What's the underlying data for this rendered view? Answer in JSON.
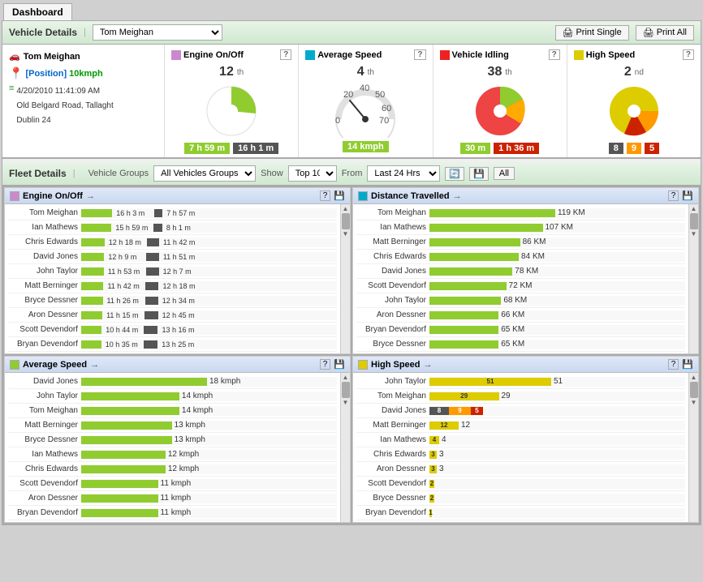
{
  "tabs": [
    {
      "label": "Dashboard"
    }
  ],
  "vehicleDetails": {
    "title": "Vehicle Details",
    "selectedVehicle": "Tom Meighan",
    "printSingle": "Print Single",
    "printAll": "Print All",
    "vehicle": {
      "name": "Tom Meighan",
      "position": "[Position]",
      "speed": "10kmph",
      "datetime": "4/20/2010 11:41:09 AM",
      "address": "Old Belgard Road, Tallaght",
      "city": "Dublin 24"
    },
    "metrics": [
      {
        "id": "engine",
        "label": "Engine On/Off",
        "color": "#cc88cc",
        "rank": "12",
        "rankSuffix": "th",
        "helpIcon": "?",
        "footer": [
          "7 h 59 m",
          "16 h 1 m"
        ],
        "footerColors": [
          "green",
          "dark"
        ]
      },
      {
        "id": "avgspeed",
        "label": "Average Speed",
        "color": "#00aacc",
        "rank": "4",
        "rankSuffix": "th",
        "helpIcon": "?",
        "footer": [
          "14 kmph"
        ],
        "footerColors": [
          "green"
        ]
      },
      {
        "id": "idling",
        "label": "Vehicle Idling",
        "color": "#ee2222",
        "rank": "38",
        "rankSuffix": "th",
        "helpIcon": "?",
        "footer": [
          "30 m",
          "1 h 36 m"
        ],
        "footerColors": [
          "green",
          "red"
        ]
      },
      {
        "id": "highspeed",
        "label": "High Speed",
        "color": "#ddcc00",
        "rank": "2",
        "rankSuffix": "nd",
        "helpIcon": "?",
        "footer": [
          "8",
          "9",
          "5"
        ],
        "footerColors": [
          "dark",
          "orange",
          "red"
        ]
      }
    ]
  },
  "fleetDetails": {
    "title": "Fleet Details",
    "vehicleGroupsLabel": "Vehicle Groups",
    "vehicleGroupsValue": "All Vehicles Groups",
    "showLabel": "Show",
    "showValue": "Top 10",
    "fromLabel": "From",
    "fromValue": "Last 24 Hrs",
    "allLabel": "All"
  },
  "engineChart": {
    "title": "Engine On/Off",
    "color": "#cc88cc",
    "rows": [
      {
        "name": "Tom Meighan",
        "val1": "16 h 3 m",
        "pct1": 85,
        "val2": "7 h 57 m",
        "pct2": 40
      },
      {
        "name": "Ian Mathews",
        "val1": "15 h 59 m",
        "pct1": 83,
        "val2": "8 h 1 m",
        "pct2": 42
      },
      {
        "name": "Chris Edwards",
        "val1": "12 h 18 m",
        "pct1": 64,
        "val2": "11 h 42 m",
        "pct2": 61
      },
      {
        "name": "David Jones",
        "val1": "12 h 9 m",
        "pct1": 63,
        "val2": "11 h 51 m",
        "pct2": 62
      },
      {
        "name": "John Taylor",
        "val1": "11 h 53 m",
        "pct1": 62,
        "val2": "12 h 7 m",
        "pct2": 63
      },
      {
        "name": "Matt Berninger",
        "val1": "11 h 42 m",
        "pct1": 61,
        "val2": "12 h 18 m",
        "pct2": 64
      },
      {
        "name": "Bryce Dessner",
        "val1": "11 h 26 m",
        "pct1": 59,
        "val2": "12 h 34 m",
        "pct2": 65
      },
      {
        "name": "Aron Dessner",
        "val1": "11 h 15 m",
        "pct1": 58,
        "val2": "12 h 45 m",
        "pct2": 66
      },
      {
        "name": "Scott Devendorf",
        "val1": "10 h 44 m",
        "pct1": 56,
        "val2": "13 h 16 m",
        "pct2": 69
      },
      {
        "name": "Bryan Devendorf",
        "val1": "10 h 35 m",
        "pct1": 55,
        "val2": "13 h 25 m",
        "pct2": 70
      }
    ]
  },
  "distanceChart": {
    "title": "Distance Travelled",
    "color": "#00aacc",
    "rows": [
      {
        "name": "Tom Meighan",
        "val": "119 KM",
        "pct": 100
      },
      {
        "name": "Ian Mathews",
        "val": "107 KM",
        "pct": 90
      },
      {
        "name": "Matt Berninger",
        "val": "86 KM",
        "pct": 72
      },
      {
        "name": "Chris Edwards",
        "val": "84 KM",
        "pct": 71
      },
      {
        "name": "David Jones",
        "val": "78 KM",
        "pct": 66
      },
      {
        "name": "Scott Devendorf",
        "val": "72 KM",
        "pct": 61
      },
      {
        "name": "John Taylor",
        "val": "68 KM",
        "pct": 57
      },
      {
        "name": "Aron Dessner",
        "val": "66 KM",
        "pct": 55
      },
      {
        "name": "Bryan Devendorf",
        "val": "65 KM",
        "pct": 55
      },
      {
        "name": "Bryce Dessner",
        "val": "65 KM",
        "pct": 55
      }
    ]
  },
  "avgSpeedChart": {
    "title": "Average Speed",
    "color": "#90cc30",
    "rows": [
      {
        "name": "David Jones",
        "val": "18 kmph",
        "pct": 100
      },
      {
        "name": "John Taylor",
        "val": "14 kmph",
        "pct": 78
      },
      {
        "name": "Tom Meighan",
        "val": "14 kmph",
        "pct": 78
      },
      {
        "name": "Matt Berninger",
        "val": "13 kmph",
        "pct": 72
      },
      {
        "name": "Bryce Dessner",
        "val": "13 kmph",
        "pct": 72
      },
      {
        "name": "Ian Mathews",
        "val": "12 kmph",
        "pct": 67
      },
      {
        "name": "Chris Edwards",
        "val": "12 kmph",
        "pct": 67
      },
      {
        "name": "Scott Devendorf",
        "val": "11 kmph",
        "pct": 61
      },
      {
        "name": "Aron Dessner",
        "val": "11 kmph",
        "pct": 61
      },
      {
        "name": "Bryan Devendorf",
        "val": "11 kmph",
        "pct": 61
      }
    ]
  },
  "highSpeedChart": {
    "title": "High Speed",
    "color": "#ddcc00",
    "rows": [
      {
        "name": "John Taylor",
        "segments": [
          {
            "val": 51,
            "pct": 100,
            "color": "yellow"
          }
        ],
        "total": "51"
      },
      {
        "name": "Tom Meighan",
        "segments": [
          {
            "val": 29,
            "pct": 57,
            "color": "yellow"
          }
        ],
        "total": "29"
      },
      {
        "name": "David Jones",
        "segments": [
          {
            "val": 8,
            "pct": 16,
            "color": "dark"
          },
          {
            "val": 9,
            "pct": 18,
            "color": "orange"
          },
          {
            "val": 5,
            "pct": 10,
            "color": "red"
          }
        ],
        "total": ""
      },
      {
        "name": "Matt Berninger",
        "segments": [
          {
            "val": 12,
            "pct": 24,
            "color": "yellow"
          }
        ],
        "total": "12"
      },
      {
        "name": "Ian Mathews",
        "segments": [
          {
            "val": 4,
            "pct": 8,
            "color": "yellow"
          }
        ],
        "total": "4"
      },
      {
        "name": "Chris Edwards",
        "segments": [
          {
            "val": 3,
            "pct": 6,
            "color": "yellow"
          }
        ],
        "total": "3"
      },
      {
        "name": "Aron Dessner",
        "segments": [
          {
            "val": 3,
            "pct": 6,
            "color": "yellow"
          }
        ],
        "total": "3"
      },
      {
        "name": "Scott Devendorf",
        "segments": [
          {
            "val": 2,
            "pct": 4,
            "color": "yellow"
          }
        ],
        "total": ""
      },
      {
        "name": "Bryce Dessner",
        "segments": [
          {
            "val": 2,
            "pct": 4,
            "color": "yellow"
          }
        ],
        "total": ""
      },
      {
        "name": "Bryan Devendorf",
        "segments": [
          {
            "val": 1,
            "pct": 2,
            "color": "yellow"
          }
        ],
        "total": ""
      }
    ]
  }
}
